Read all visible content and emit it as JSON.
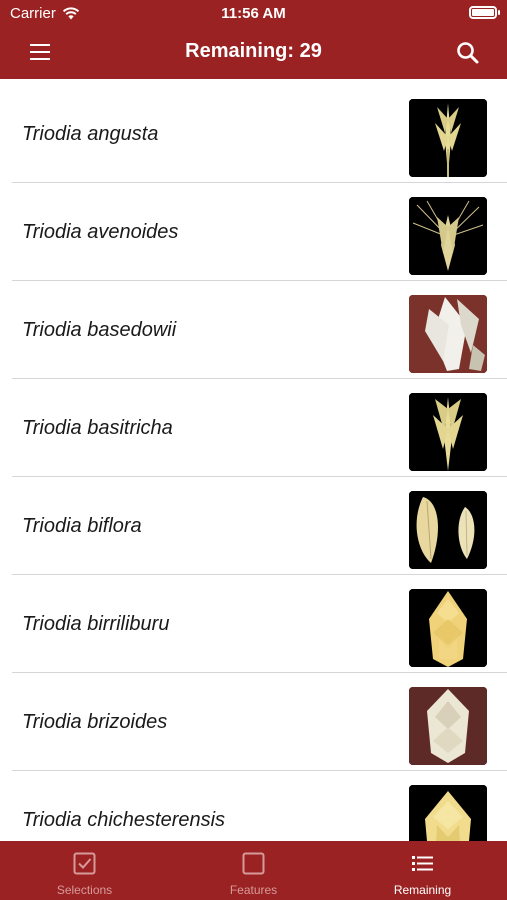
{
  "status_bar": {
    "carrier": "Carrier",
    "time": "11:56 AM"
  },
  "nav": {
    "title": "Remaining: 29",
    "menu_icon": "hamburger-menu-icon",
    "search_icon": "search-icon"
  },
  "species": [
    {
      "name": "Triodia angusta",
      "thumb": "black-bg-pale-spikelet"
    },
    {
      "name": "Triodia avenoides",
      "thumb": "black-bg-awned-spikelet"
    },
    {
      "name": "Triodia basedowii",
      "thumb": "red-bg-white-spikelet"
    },
    {
      "name": "Triodia basitricha",
      "thumb": "black-bg-pale-spikelet"
    },
    {
      "name": "Triodia biflora",
      "thumb": "black-bg-two-florets"
    },
    {
      "name": "Triodia birriliburu",
      "thumb": "black-bg-yellow-spikelet"
    },
    {
      "name": "Triodia brizoides",
      "thumb": "red-bg-white-spikelet"
    },
    {
      "name": "Triodia chichesterensis",
      "thumb": "black-bg-yellow-spikelet"
    }
  ],
  "tabs": [
    {
      "label": "Selections",
      "icon": "checkbox-checked-icon",
      "active": false
    },
    {
      "label": "Features",
      "icon": "checkbox-empty-icon",
      "active": false
    },
    {
      "label": "Remaining",
      "icon": "list-icon",
      "active": true
    }
  ],
  "colors": {
    "brand": "#9b2222",
    "tab_inactive": "#d79a9a",
    "tab_active": "#ffffff"
  }
}
